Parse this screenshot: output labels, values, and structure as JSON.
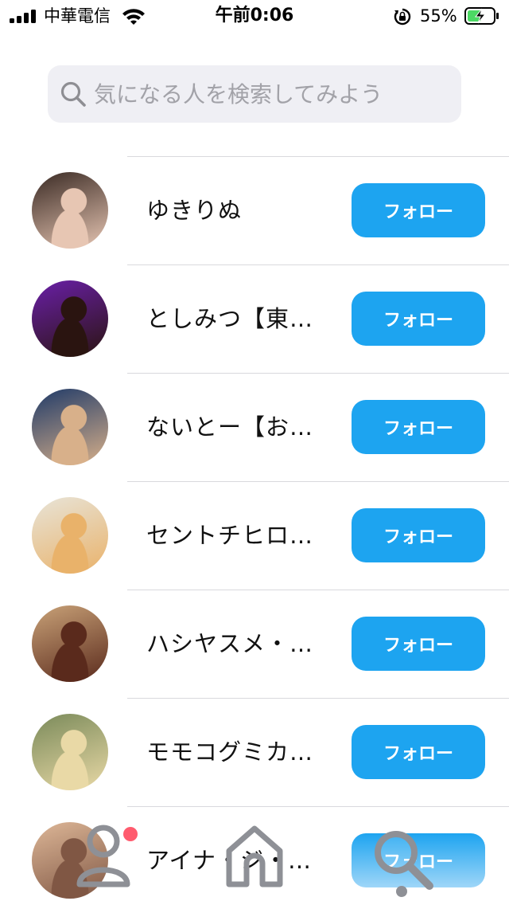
{
  "status_bar": {
    "carrier": "中華電信",
    "time": "午前0:06",
    "battery_percent": "55%",
    "signal_bars": 4,
    "battery_level": 0.55,
    "icons": [
      "signal-icon",
      "wifi-icon",
      "rotation-lock-icon",
      "battery-charging-icon"
    ]
  },
  "search": {
    "placeholder": "気になる人を検索してみよう",
    "value": "",
    "icon": "search-icon"
  },
  "users": [
    {
      "name": "ゆきりぬ",
      "follow_label": "フォロー",
      "avatar_palette": [
        "#3a2a24",
        "#e7c6b3"
      ]
    },
    {
      "name": "としみつ【東…",
      "follow_label": "フォロー",
      "avatar_palette": [
        "#6a1fa8",
        "#2a1410"
      ]
    },
    {
      "name": "ないとー【お…",
      "follow_label": "フォロー",
      "avatar_palette": [
        "#1f3a68",
        "#d8b08a"
      ]
    },
    {
      "name": "セントチヒロ…",
      "follow_label": "フォロー",
      "avatar_palette": [
        "#e8e4d8",
        "#e9b26a"
      ]
    },
    {
      "name": "ハシヤスメ・…",
      "follow_label": "フォロー",
      "avatar_palette": [
        "#c9a278",
        "#5a2a1c"
      ]
    },
    {
      "name": "モモコグミカ…",
      "follow_label": "フォロー",
      "avatar_palette": [
        "#7a8a5a",
        "#e9d9a6"
      ]
    },
    {
      "name": "アイナ・ジ・…",
      "follow_label": "フォロー",
      "avatar_palette": [
        "#d8ab86",
        "#6a3a24"
      ]
    }
  ],
  "tab_bar": {
    "items": [
      {
        "icon": "people-icon",
        "badge": true
      },
      {
        "icon": "home-icon",
        "badge": false
      },
      {
        "icon": "search-icon",
        "badge": false,
        "selected": true
      }
    ]
  },
  "colors": {
    "accent": "#1da4f0",
    "search_bg": "#efeff4",
    "placeholder": "#a2a2a8",
    "separator": "#d9d9dd",
    "tab_icon": "#8e9096",
    "badge": "#ff5b6e"
  }
}
